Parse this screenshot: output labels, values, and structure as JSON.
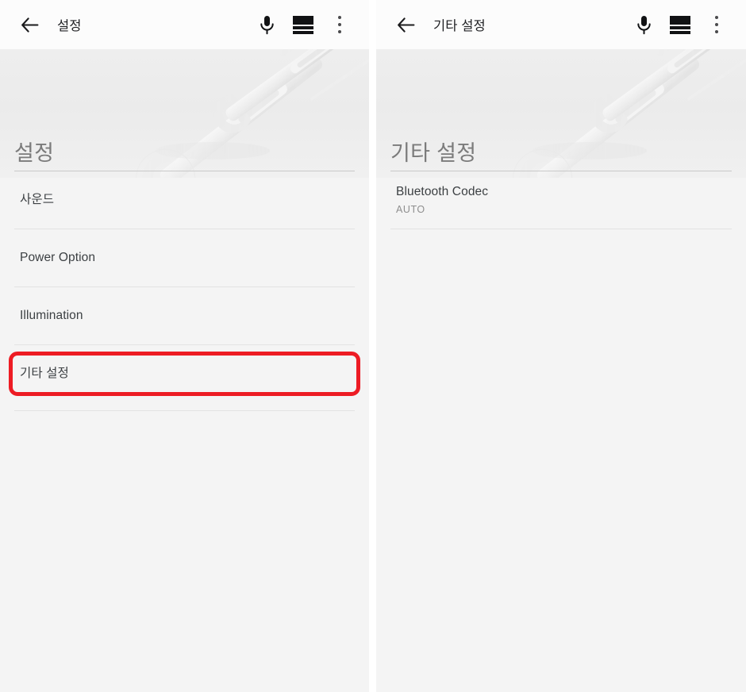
{
  "meta": {
    "accent_red": "#ed1c24",
    "panel_bg": "#f4f4f4",
    "toolbar_bg": "#fcfcfc",
    "divider": "#e2e2e2",
    "title_color": "#7b7b7b"
  },
  "panels": [
    {
      "id": "settings-panel",
      "toolbar": {
        "back_label": "back-arrow",
        "title": "설정",
        "actions": [
          {
            "name": "microphone-icon",
            "label": "Voice input"
          },
          {
            "name": "layers-icon",
            "label": "Layers"
          },
          {
            "name": "overflow-menu-icon",
            "label": "More options"
          }
        ]
      },
      "hero": {
        "art": "wrench-tools-watermark"
      },
      "section_title": "설정",
      "rows": [
        {
          "title": "사운드",
          "sub": "",
          "highlighted": false
        },
        {
          "title": "Power Option",
          "sub": "",
          "highlighted": false
        },
        {
          "title": "Illumination",
          "sub": "",
          "highlighted": false
        },
        {
          "title": "기타 설정",
          "sub": "",
          "highlighted": true
        }
      ]
    },
    {
      "id": "other-settings-panel",
      "toolbar": {
        "back_label": "back-arrow",
        "title": "기타 설정",
        "actions": [
          {
            "name": "microphone-icon",
            "label": "Voice input"
          },
          {
            "name": "layers-icon",
            "label": "Layers"
          },
          {
            "name": "overflow-menu-icon",
            "label": "More options"
          }
        ]
      },
      "hero": {
        "art": "wrench-tools-watermark"
      },
      "section_title": "기타 설정",
      "rows": [
        {
          "title": "Bluetooth Codec",
          "sub": "AUTO",
          "highlighted": false
        }
      ]
    }
  ]
}
